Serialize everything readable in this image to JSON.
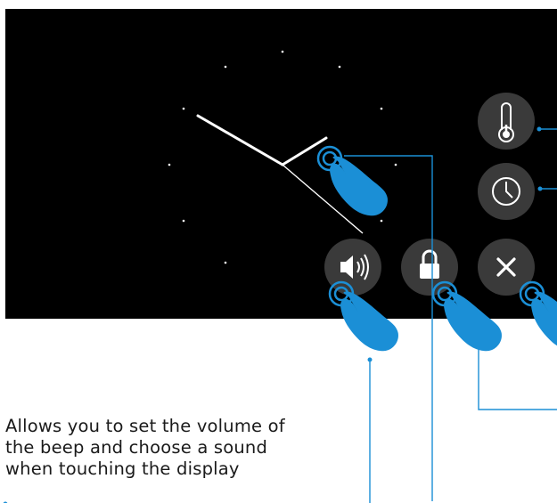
{
  "colors": {
    "screen": "#000000",
    "button": "#3a3a3a",
    "hand": "#1b8fd6",
    "callout": "#1b8fd6",
    "caption_text": "#1a1a1a"
  },
  "clock": {
    "style": "analog",
    "hands": [
      "hour-hand",
      "minute-hand"
    ]
  },
  "buttons": [
    {
      "name": "thermometer-button",
      "icon": "thermometer-icon"
    },
    {
      "name": "clock-button",
      "icon": "clock-icon"
    },
    {
      "name": "volume-button",
      "icon": "speaker-icon"
    },
    {
      "name": "lock-button",
      "icon": "lock-icon"
    },
    {
      "name": "close-button",
      "icon": "close-icon"
    }
  ],
  "caption": {
    "line1": "Allows you to set the volume of",
    "line2": "the beep and choose a sound",
    "line3": "when touching the display"
  }
}
